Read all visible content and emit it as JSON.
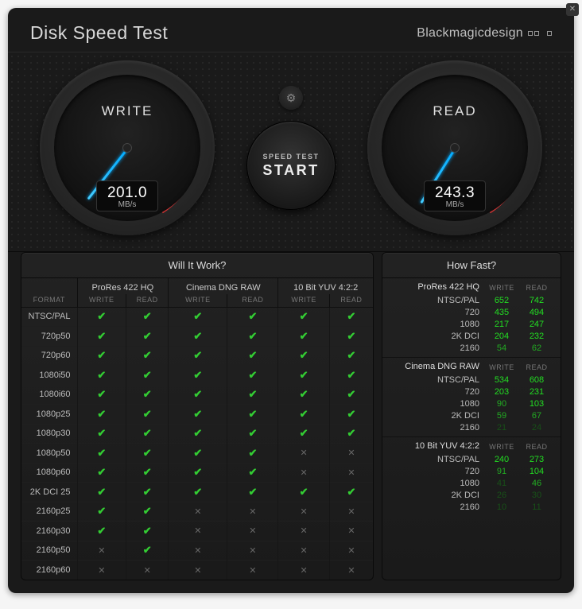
{
  "app": {
    "title": "Disk Speed Test",
    "brand": "Blackmagicdesign"
  },
  "gauges": {
    "write": {
      "label": "WRITE",
      "value": "201.0",
      "unit": "MB/s",
      "angle": 128
    },
    "read": {
      "label": "READ",
      "value": "243.3",
      "unit": "MB/s",
      "angle": 122
    }
  },
  "controls": {
    "speed_test_small": "SPEED TEST",
    "speed_test_big": "START"
  },
  "wiw": {
    "title": "Will It Work?",
    "format_label": "FORMAT",
    "codecs": [
      "ProRes 422 HQ",
      "Cinema DNG RAW",
      "10 Bit YUV 4:2:2"
    ],
    "sub": [
      "WRITE",
      "READ"
    ],
    "rows": [
      {
        "fmt": "NTSC/PAL",
        "cells": [
          true,
          true,
          true,
          true,
          true,
          true
        ]
      },
      {
        "fmt": "720p50",
        "cells": [
          true,
          true,
          true,
          true,
          true,
          true
        ]
      },
      {
        "fmt": "720p60",
        "cells": [
          true,
          true,
          true,
          true,
          true,
          true
        ]
      },
      {
        "fmt": "1080i50",
        "cells": [
          true,
          true,
          true,
          true,
          true,
          true
        ]
      },
      {
        "fmt": "1080i60",
        "cells": [
          true,
          true,
          true,
          true,
          true,
          true
        ]
      },
      {
        "fmt": "1080p25",
        "cells": [
          true,
          true,
          true,
          true,
          true,
          true
        ]
      },
      {
        "fmt": "1080p30",
        "cells": [
          true,
          true,
          true,
          true,
          true,
          true
        ]
      },
      {
        "fmt": "1080p50",
        "cells": [
          true,
          true,
          true,
          true,
          false,
          false
        ]
      },
      {
        "fmt": "1080p60",
        "cells": [
          true,
          true,
          true,
          true,
          false,
          false
        ]
      },
      {
        "fmt": "2K DCI 25",
        "cells": [
          true,
          true,
          true,
          true,
          true,
          true
        ]
      },
      {
        "fmt": "2160p25",
        "cells": [
          true,
          true,
          false,
          false,
          false,
          false
        ]
      },
      {
        "fmt": "2160p30",
        "cells": [
          true,
          true,
          false,
          false,
          false,
          false
        ]
      },
      {
        "fmt": "2160p50",
        "cells": [
          false,
          true,
          false,
          false,
          false,
          false
        ]
      },
      {
        "fmt": "2160p60",
        "cells": [
          false,
          false,
          false,
          false,
          false,
          false
        ]
      }
    ]
  },
  "hf": {
    "title": "How Fast?",
    "write_label": "WRITE",
    "read_label": "READ",
    "sections": [
      {
        "codec": "ProRes 422 HQ",
        "rows": [
          {
            "fmt": "NTSC/PAL",
            "w": "652",
            "r": "742",
            "wc": "g1",
            "rc": "g1"
          },
          {
            "fmt": "720",
            "w": "435",
            "r": "494",
            "wc": "g1",
            "rc": "g1"
          },
          {
            "fmt": "1080",
            "w": "217",
            "r": "247",
            "wc": "g1",
            "rc": "g1"
          },
          {
            "fmt": "2K DCI",
            "w": "204",
            "r": "232",
            "wc": "g1",
            "rc": "g1"
          },
          {
            "fmt": "2160",
            "w": "54",
            "r": "62",
            "wc": "g2",
            "rc": "g2"
          }
        ]
      },
      {
        "codec": "Cinema DNG RAW",
        "rows": [
          {
            "fmt": "NTSC/PAL",
            "w": "534",
            "r": "608",
            "wc": "g1",
            "rc": "g1"
          },
          {
            "fmt": "720",
            "w": "203",
            "r": "231",
            "wc": "g1",
            "rc": "g1"
          },
          {
            "fmt": "1080",
            "w": "90",
            "r": "103",
            "wc": "g2",
            "rc": "g1"
          },
          {
            "fmt": "2K DCI",
            "w": "59",
            "r": "67",
            "wc": "g2",
            "rc": "g2"
          },
          {
            "fmt": "2160",
            "w": "21",
            "r": "24",
            "wc": "g3",
            "rc": "g3"
          }
        ]
      },
      {
        "codec": "10 Bit YUV 4:2:2",
        "rows": [
          {
            "fmt": "NTSC/PAL",
            "w": "240",
            "r": "273",
            "wc": "g1",
            "rc": "g1"
          },
          {
            "fmt": "720",
            "w": "91",
            "r": "104",
            "wc": "g2",
            "rc": "g1"
          },
          {
            "fmt": "1080",
            "w": "41",
            "r": "46",
            "wc": "g3",
            "rc": "g2"
          },
          {
            "fmt": "2K DCI",
            "w": "26",
            "r": "30",
            "wc": "g3",
            "rc": "g3"
          },
          {
            "fmt": "2160",
            "w": "10",
            "r": "11",
            "wc": "g3",
            "rc": "g3"
          }
        ]
      }
    ]
  }
}
